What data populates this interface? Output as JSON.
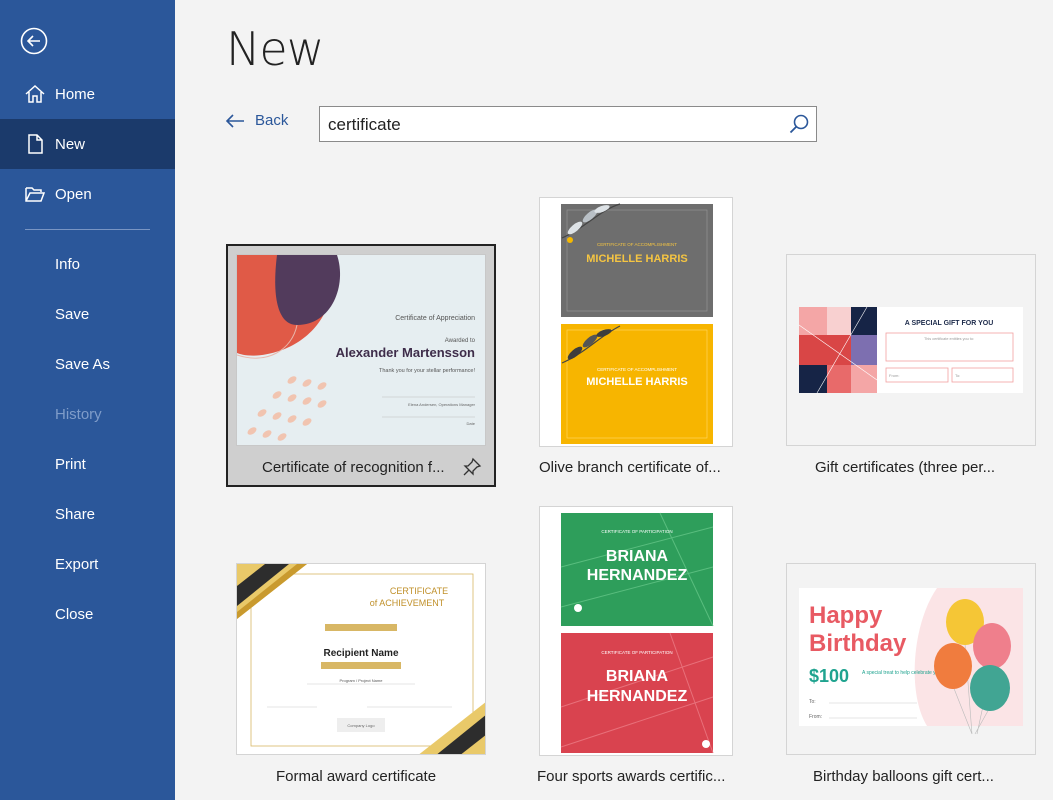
{
  "sidebar": {
    "items": [
      {
        "label": "Home"
      },
      {
        "label": "New"
      },
      {
        "label": "Open"
      },
      {
        "label": "Info"
      },
      {
        "label": "Save"
      },
      {
        "label": "Save As"
      },
      {
        "label": "History"
      },
      {
        "label": "Print"
      },
      {
        "label": "Share"
      },
      {
        "label": "Export"
      },
      {
        "label": "Close"
      }
    ]
  },
  "main": {
    "title": "New",
    "back_label": "Back",
    "search": {
      "value": "certificate"
    }
  },
  "templates": [
    {
      "label": "Certificate of recognition f...",
      "t1": "Certificate of Appreciation",
      "t2": "Awarded to",
      "t3": "Alexander Martensson",
      "t4": "Thank you for your stellar performance!",
      "t5": "Elena Andersen, Operations Manager",
      "t6": "Date"
    },
    {
      "label": "Olive branch certificate of...",
      "t1": "CERTIFICATE OF ACCOMPLISHMENT",
      "t2": "MICHELLE HARRIS",
      "t3": "CERTIFICATE OF ACCOMPLISHMENT",
      "t4": "MICHELLE HARRIS"
    },
    {
      "label": "Gift certificates (three per...",
      "t1": "A SPECIAL GIFT FOR YOU",
      "t2": "This certificate entitles you to:",
      "t3": "From:",
      "t4": "To:"
    },
    {
      "label": "Formal award certificate",
      "t1": "CERTIFICATE",
      "t2": "of ACHIEVEMENT",
      "t3": "Recipient Name",
      "t4": "Program / Project Name",
      "t5": "Company Logo"
    },
    {
      "label": "Four sports awards certific...",
      "t1": "CERTIFICATE OF PARTICIPATION",
      "t2": "BRIANA",
      "t3": "HERNANDEZ",
      "t4": "CERTIFICATE OF PARTICIPATION",
      "t5": "BRIANA",
      "t6": "HERNANDEZ"
    },
    {
      "label": "Birthday balloons gift cert...",
      "t1": "Happy",
      "t2": "Birthday",
      "t3": "$100",
      "t4": "A special treat to help celebrate your big day",
      "t5": "To:",
      "t6": "From:"
    }
  ],
  "colors": {
    "sidebar": "#2b579a",
    "sidebar_active": "#1b3a6b",
    "accent": "#2b579a"
  }
}
